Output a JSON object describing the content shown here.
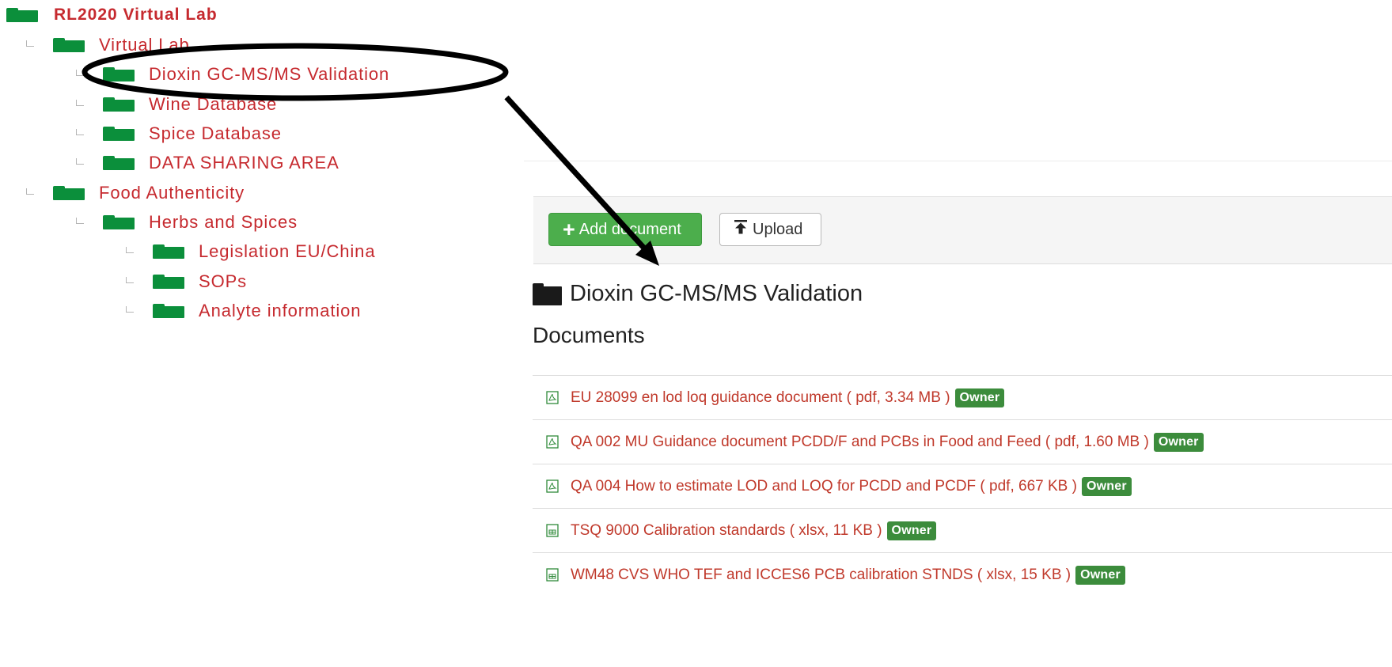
{
  "tree": {
    "root": {
      "label": "RL2020 Virtual Lab",
      "icon": "folder-icon"
    },
    "items": [
      {
        "label": "Virtual Lab",
        "level": 1
      },
      {
        "label": "Dioxin GC-MS/MS Validation",
        "level": 2
      },
      {
        "label": "Wine Database",
        "level": 2
      },
      {
        "label": "Spice Database",
        "level": 2
      },
      {
        "label": "DATA SHARING AREA",
        "level": 2
      },
      {
        "label": "Food Authenticity",
        "level": 1
      },
      {
        "label": "Herbs and Spices",
        "level": 2
      },
      {
        "label": "Legislation EU/China",
        "level": 3
      },
      {
        "label": "SOPs",
        "level": 3
      },
      {
        "label": "Analyte information",
        "level": 3
      }
    ]
  },
  "toolbar": {
    "add_label": "Add document",
    "upload_label": "Upload"
  },
  "folder_view": {
    "title": "Dioxin GC-MS/MS Validation",
    "documents_heading": "Documents",
    "documents": [
      {
        "title": "EU 28099 en lod loq guidance document ( pdf, 3.34 MB )",
        "type": "pdf",
        "badge": "Owner"
      },
      {
        "title": "QA 002 MU Guidance document PCDD/F and PCBs in Food and Feed ( pdf, 1.60 MB )",
        "type": "pdf",
        "badge": "Owner"
      },
      {
        "title": "QA 004 How to estimate LOD and LOQ for PCDD and PCDF ( pdf, 667 KB )",
        "type": "pdf",
        "badge": "Owner"
      },
      {
        "title": "TSQ 9000 Calibration standards ( xlsx, 11 KB )",
        "type": "xlsx",
        "badge": "Owner"
      },
      {
        "title": "WM48 CVS WHO TEF and ICCES6 PCB calibration STNDS ( xlsx, 15 KB )",
        "type": "xlsx",
        "badge": "Owner"
      }
    ]
  },
  "colors": {
    "folder_green": "#0b8f3b",
    "link_red": "#c62a2f",
    "add_button_green": "#4cae4c",
    "owner_badge_green": "#3c8c3c"
  }
}
